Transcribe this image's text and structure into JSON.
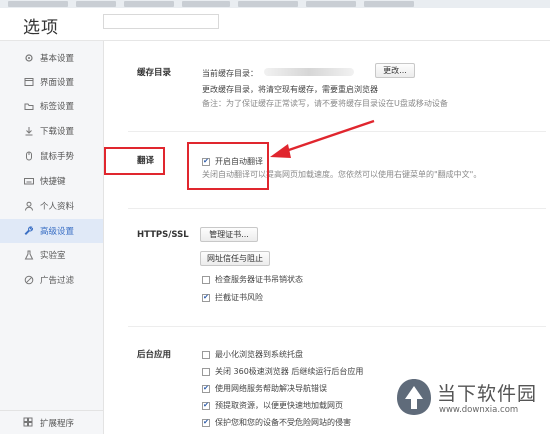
{
  "window": {
    "title": "选项"
  },
  "sidebar": {
    "items": [
      {
        "label": "基本设置",
        "icon": "gear-icon",
        "active": false
      },
      {
        "label": "界面设置",
        "icon": "window-icon",
        "active": false
      },
      {
        "label": "标签设置",
        "icon": "tabs-icon",
        "active": false
      },
      {
        "label": "下载设置",
        "icon": "download-icon",
        "active": false
      },
      {
        "label": "鼠标手势",
        "icon": "mouse-icon",
        "active": false
      },
      {
        "label": "快捷键",
        "icon": "keyboard-icon",
        "active": false
      },
      {
        "label": "个人资料",
        "icon": "person-icon",
        "active": false
      },
      {
        "label": "高级设置",
        "icon": "wrench-icon",
        "active": true
      },
      {
        "label": "实验室",
        "icon": "lab-icon",
        "active": false
      },
      {
        "label": "广告过滤",
        "icon": "block-icon",
        "active": false
      }
    ],
    "bottom": {
      "label": "扩展程序",
      "icon": "extension-icon"
    }
  },
  "cache": {
    "label": "缓存目录",
    "current_dir_label": "当前缓存目录：",
    "change_button": "更改...",
    "info": "更改缓存目录，将清空现有缓存，需要重启浏览器",
    "note": "备注：为了保证缓存正常读写，请不要将缓存目录设在U盘或移动设备"
  },
  "translate": {
    "label": "翻译",
    "checkbox_label": "开启自动翻译",
    "checked": true,
    "description": "关闭自动翻译可以提高网页加载速度。您依然可以使用右键菜单的\"翻成中文\"。"
  },
  "https": {
    "label": "HTTPS/SSL",
    "manage_cert_button": "管理证书...",
    "site_trust_button": "网址信任与阻止",
    "options": [
      {
        "label": "检查服务器证书吊销状态",
        "checked": false
      },
      {
        "label": "拦截证书风险",
        "checked": true
      }
    ]
  },
  "background": {
    "label": "后台应用",
    "options": [
      {
        "label": "最小化浏览器到系统托盘",
        "checked": false
      },
      {
        "label": "关闭 360极速浏览器 后继续运行后台应用",
        "checked": false
      },
      {
        "label": "使用网络服务帮助解决导航错误",
        "checked": true
      },
      {
        "label": "预提取资源，以便更快速地加载网页",
        "checked": true
      },
      {
        "label": "保护您和您的设备不受危险网站的侵害",
        "checked": true
      }
    ]
  },
  "watermark": {
    "title": "当下软件园",
    "url": "www.downxia.com"
  },
  "colors": {
    "accent": "#3a6fc4",
    "highlight": "#e0262e"
  }
}
